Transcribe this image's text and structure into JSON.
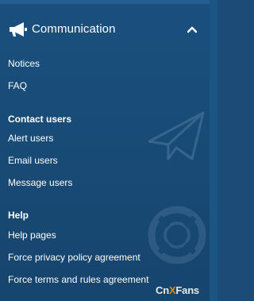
{
  "section": {
    "title": "Communication",
    "icon": "megaphone-icon",
    "collapse_icon": "chevron-up-icon"
  },
  "links": {
    "notices": "Notices",
    "faq": "FAQ"
  },
  "contact_users": {
    "heading": "Contact users",
    "alert": "Alert users",
    "email": "Email users",
    "message": "Message users"
  },
  "help": {
    "heading": "Help",
    "pages": "Help pages",
    "privacy": "Force privacy policy agreement",
    "terms": "Force terms and rules agreement"
  },
  "watermark": {
    "prefix": "Cn",
    "accent": "X",
    "suffix": "Fans"
  },
  "colors": {
    "panel_background": "#1a4f7d",
    "text": "#ffffff",
    "watermark_accent": "#ff7a1a"
  }
}
